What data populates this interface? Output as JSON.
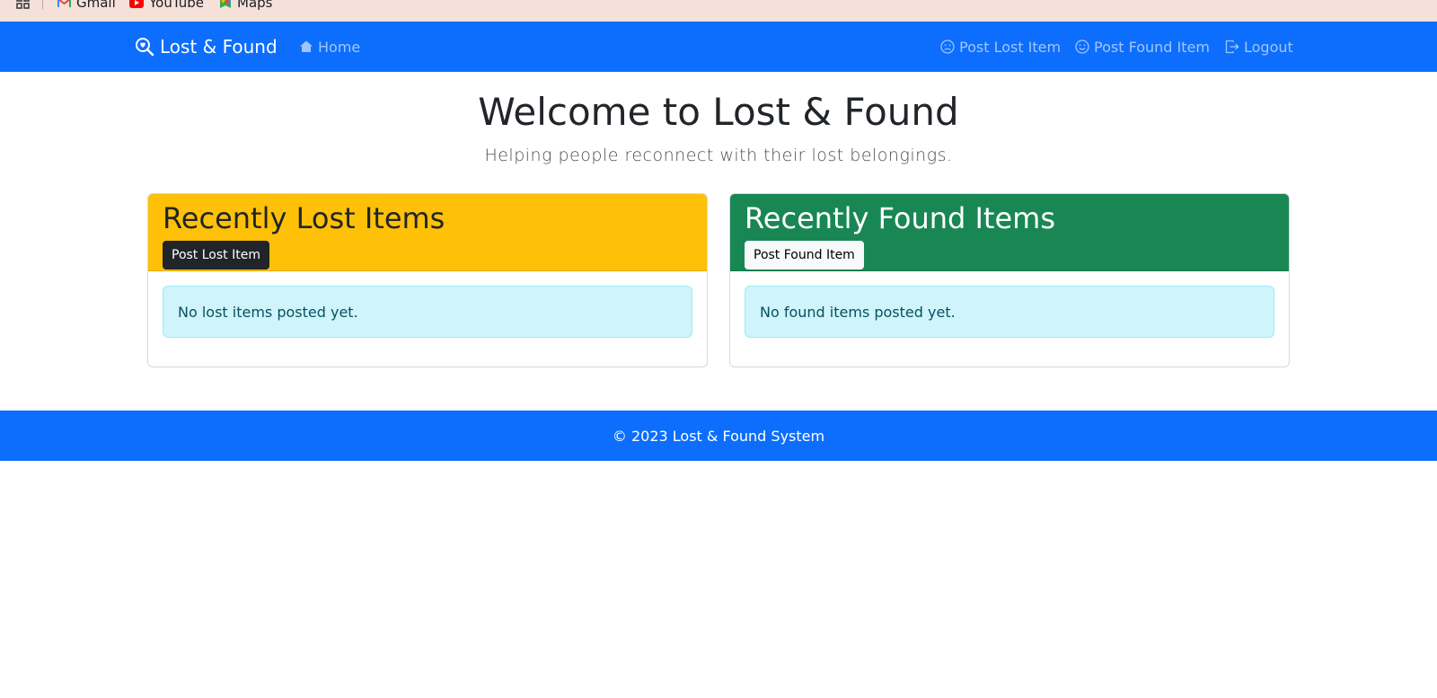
{
  "bookmarks": {
    "items": [
      {
        "label": "Gmail",
        "icon": "gmail-icon"
      },
      {
        "label": "YouTube",
        "icon": "youtube-icon"
      },
      {
        "label": "Maps",
        "icon": "maps-icon"
      }
    ]
  },
  "navbar": {
    "brand": "Lost & Found",
    "home": "Home",
    "post_lost": "Post Lost Item",
    "post_found": "Post Found Item",
    "logout": "Logout"
  },
  "hero": {
    "title": "Welcome to Lost & Found",
    "subtitle": "Helping people reconnect with their lost belongings."
  },
  "lost_card": {
    "title": "Recently Lost Items",
    "button": "Post Lost Item",
    "empty_message": "No lost items posted yet."
  },
  "found_card": {
    "title": "Recently Found Items",
    "button": "Post Found Item",
    "empty_message": "No found items posted yet."
  },
  "footer": {
    "text": "© 2023 Lost & Found System"
  },
  "colors": {
    "primary": "#0d6efd",
    "warning": "#ffc107",
    "success": "#198754",
    "info_bg": "#cff4fc",
    "bookmarks_bg": "#f5e1da"
  }
}
